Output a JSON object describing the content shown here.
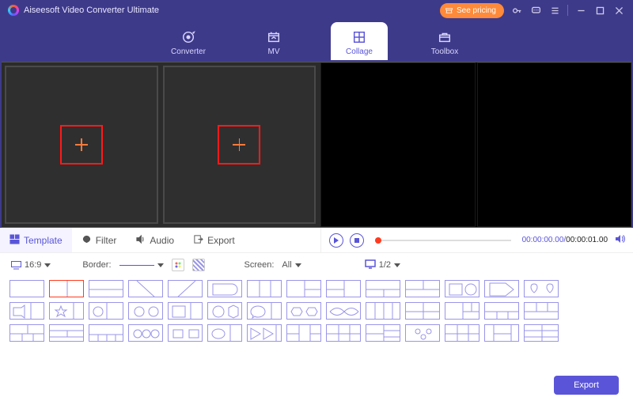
{
  "app": {
    "title": "Aiseesoft Video Converter Ultimate"
  },
  "pricing": {
    "label": "See pricing"
  },
  "tabs": {
    "converter": "Converter",
    "mv": "MV",
    "collage": "Collage",
    "toolbox": "Toolbox"
  },
  "subtabs": {
    "template": "Template",
    "filter": "Filter",
    "audio": "Audio",
    "export": "Export"
  },
  "playback": {
    "current": "00:00:00.00",
    "total": "00:00:01.00"
  },
  "options": {
    "aspect": "16:9",
    "border_label": "Border:",
    "screen_label": "Screen:",
    "screen_value": "All",
    "page": "1/2"
  },
  "footer": {
    "export": "Export"
  }
}
